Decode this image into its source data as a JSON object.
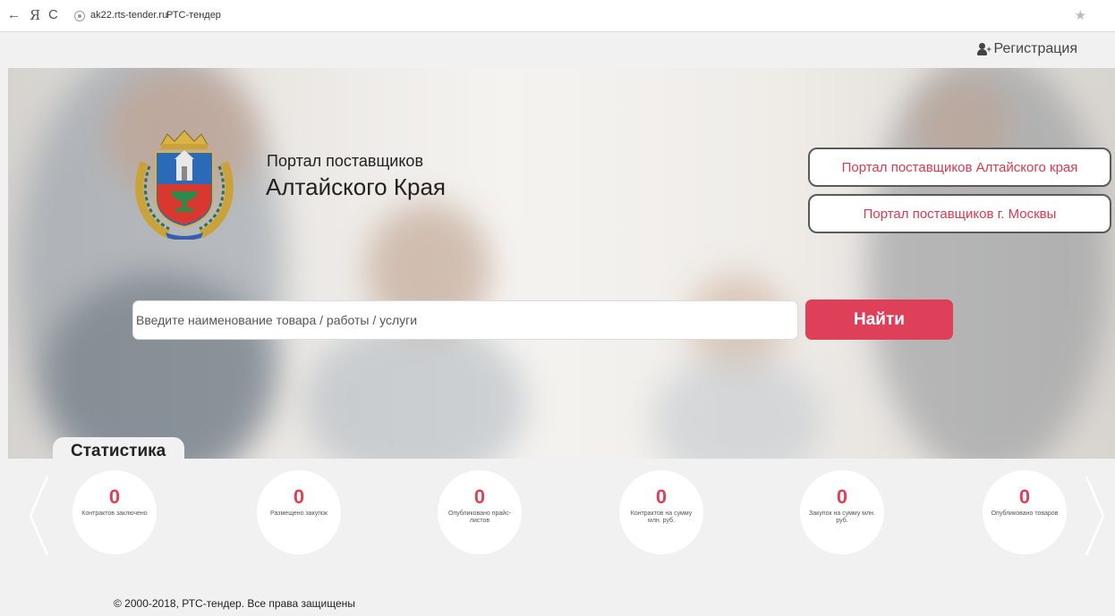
{
  "browser": {
    "back_icon": "←",
    "ya_icon": "Я",
    "reload_icon": "C",
    "url_domain": "ak22.rts-tender.ru",
    "page_title": "РТС-тендер",
    "star_icon": "★"
  },
  "header": {
    "register_label": "Регистрация"
  },
  "hero": {
    "title_line1": "Портал поставщиков",
    "title_line2": "Алтайского Края",
    "portal_buttons": [
      "Портал поставщиков Алтайского края",
      "Портал поставщиков г. Москвы"
    ],
    "search_placeholder": "Введите наименование товара / работы / услуги",
    "search_button": "Найти"
  },
  "stats": {
    "title": "Статистика",
    "items": [
      {
        "value": "0",
        "label": "Контрактов заключено"
      },
      {
        "value": "0",
        "label": "Размещено закупок"
      },
      {
        "value": "0",
        "label": "Опубликовано прайс-листов"
      },
      {
        "value": "0",
        "label": "Контрактов на сумму млн. руб."
      },
      {
        "value": "0",
        "label": "Закупок на сумму млн. руб."
      },
      {
        "value": "0",
        "label": "Опубликовано товаров"
      }
    ]
  },
  "footer": {
    "copyright": "© 2000-2018, РТС-тендер. Все права защищены"
  },
  "colors": {
    "accent": "#df4059",
    "button_text": "#d93a52"
  }
}
